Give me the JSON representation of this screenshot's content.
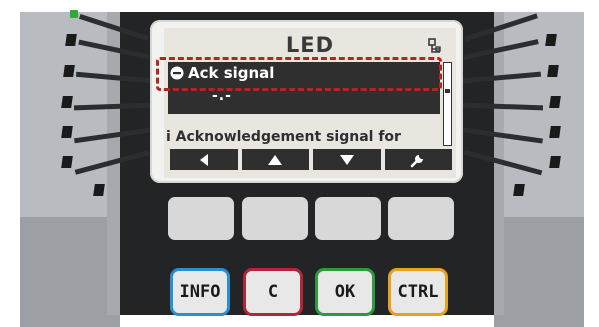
{
  "screen": {
    "title": "LED",
    "selected_item": {
      "label": "Ack signal",
      "value": "-.-"
    },
    "info_text": "i Acknowledgement signal for",
    "softkeys": [
      {
        "icon": "triangle-left-icon"
      },
      {
        "icon": "triangle-up-icon"
      },
      {
        "icon": "triangle-down-icon"
      },
      {
        "icon": "wrench-icon"
      }
    ]
  },
  "hard_keys": {
    "info": "INFO",
    "c": "C",
    "ok": "OK",
    "ctrl": "CTRL"
  },
  "colors": {
    "info_key": "#2a8fcf",
    "c_key": "#b3263a",
    "ok_key": "#2e9a3e",
    "ctrl_key": "#e5a21e",
    "highlight": "#b3261e",
    "led_on": "#2faa3a"
  }
}
